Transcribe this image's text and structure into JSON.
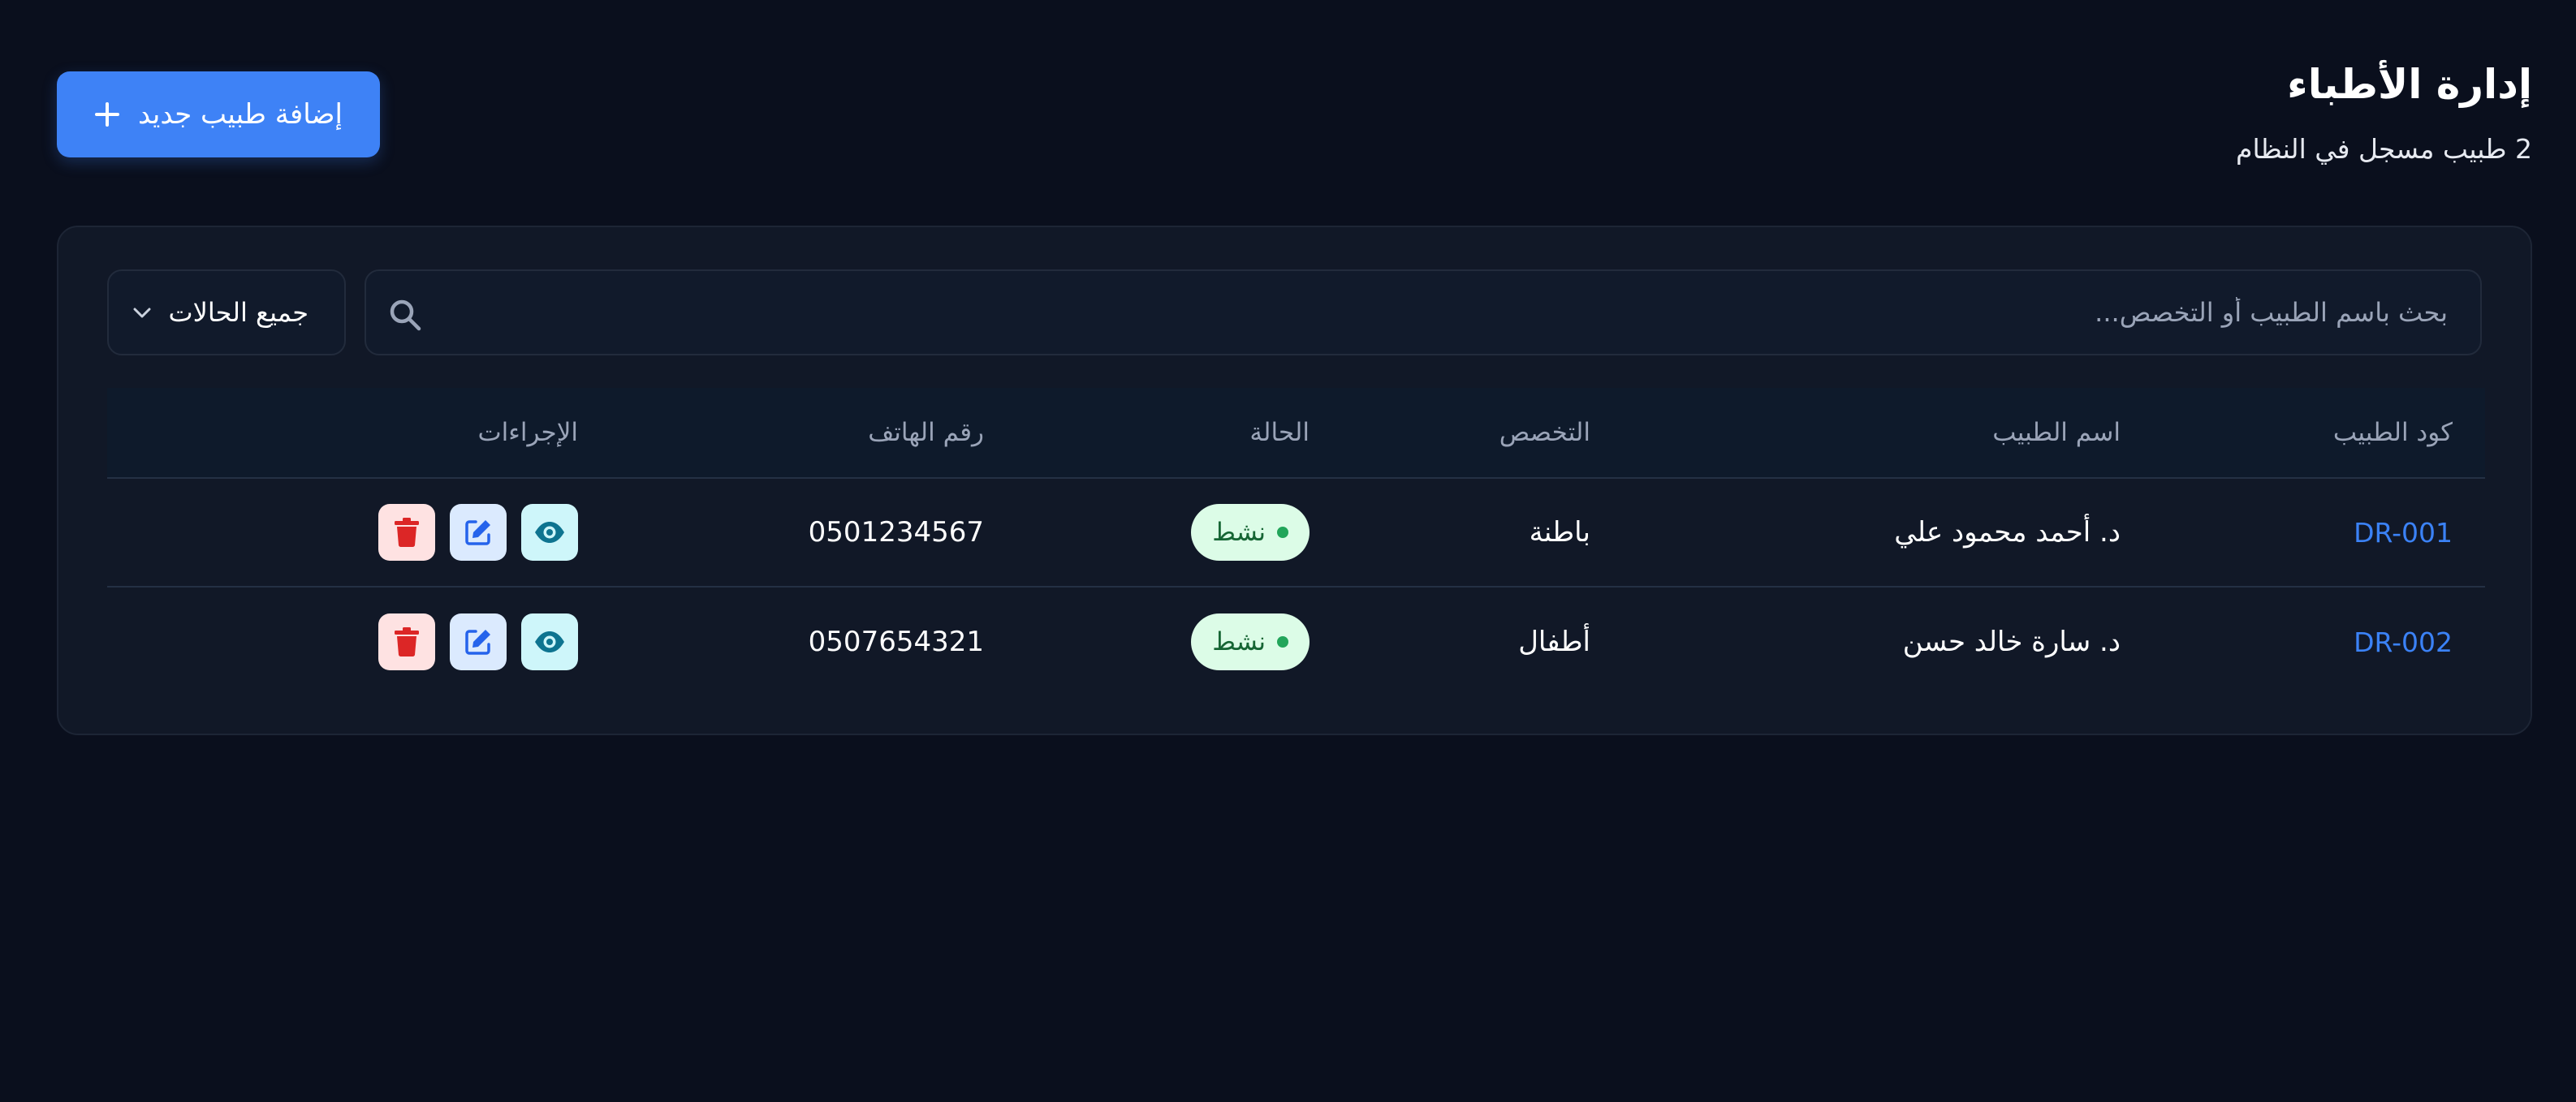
{
  "header": {
    "title": "إدارة الأطباء",
    "subtitle": "2 طبيب مسجل في النظام",
    "add_button_label": "إضافة طبيب جديد"
  },
  "filters": {
    "search_placeholder": "بحث باسم الطبيب أو التخصص...",
    "status_selected": "جميع الحالات"
  },
  "table": {
    "columns": {
      "code": "كود الطبيب",
      "name": "اسم الطبيب",
      "specialty": "التخصص",
      "status": "الحالة",
      "phone": "رقم الهاتف",
      "actions": "الإجراءات"
    },
    "rows": [
      {
        "code": "DR-001",
        "name": "د. أحمد محمود علي",
        "specialty": "باطنة",
        "status": "نشط",
        "phone": "0501234567"
      },
      {
        "code": "DR-002",
        "name": "د. سارة خالد حسن",
        "specialty": "أطفال",
        "status": "نشط",
        "phone": "0507654321"
      }
    ]
  },
  "colors": {
    "background": "#0a0f1d",
    "card": "#111827",
    "accent": "#3e82f6",
    "code_link": "#3b82f6",
    "status_active_bg": "#dcfce7",
    "status_active_text": "#166534",
    "view_action": "#0e7490",
    "edit_action": "#2563eb",
    "delete_action": "#dc2626"
  },
  "icons": {
    "add": "plus-icon",
    "search": "search-icon",
    "dropdown": "chevron-down-icon",
    "view": "eye-icon",
    "edit": "edit-icon",
    "delete": "trash-icon"
  }
}
